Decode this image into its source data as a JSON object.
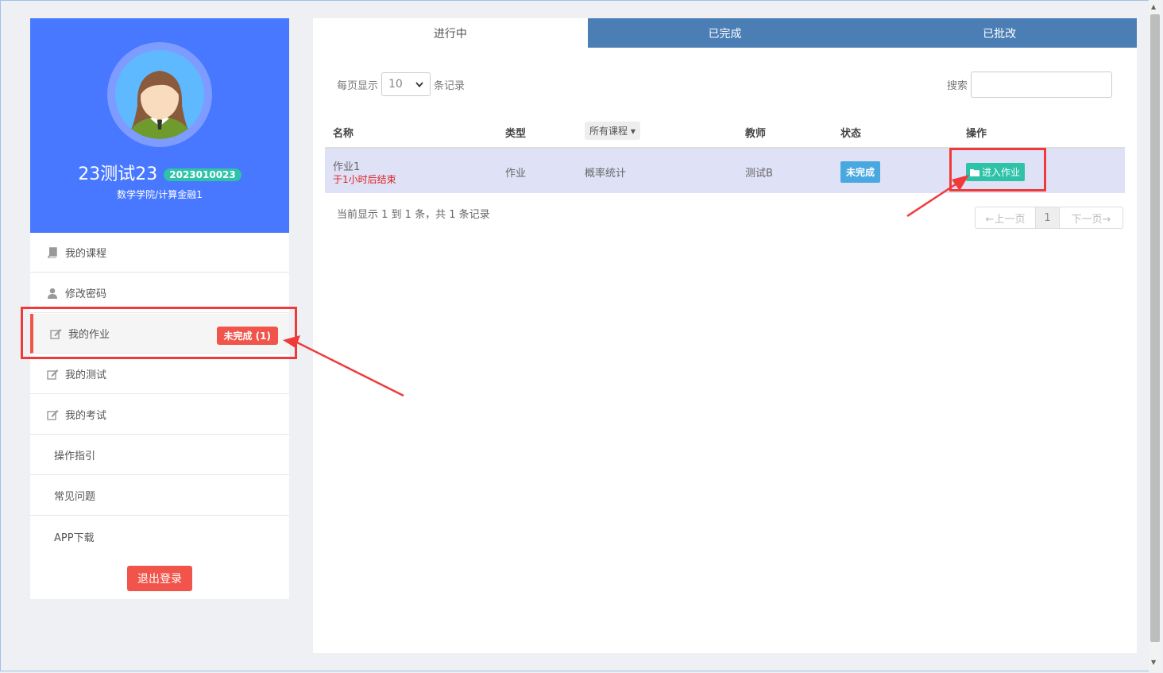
{
  "user": {
    "name": "23测试23",
    "student_id": "2023010023",
    "department": "数学学院/计算金融1"
  },
  "sidebar": {
    "items": [
      {
        "label": "我的课程",
        "icon": "book-icon"
      },
      {
        "label": "修改密码",
        "icon": "user-icon"
      },
      {
        "label": "我的作业",
        "icon": "edit-icon",
        "badge": "未完成 (1)"
      },
      {
        "label": "我的测试",
        "icon": "edit-icon"
      },
      {
        "label": "我的考试",
        "icon": "edit-icon"
      },
      {
        "label": "操作指引"
      },
      {
        "label": "常见问题"
      },
      {
        "label": "APP下载"
      }
    ],
    "logout_label": "退出登录"
  },
  "tabs": [
    {
      "label": "进行中",
      "active": true
    },
    {
      "label": "已完成",
      "active": false
    },
    {
      "label": "已批改",
      "active": false
    }
  ],
  "controls": {
    "per_page_prefix": "每页显示",
    "per_page_value": "10",
    "per_page_suffix": "条记录",
    "search_label": "搜索"
  },
  "table": {
    "headers": {
      "name": "名称",
      "type": "类型",
      "course_filter": "所有课程",
      "teacher": "教师",
      "status": "状态",
      "action": "操作"
    },
    "rows": [
      {
        "name": "作业1",
        "deadline": "于1小时后结束",
        "type": "作业",
        "course": "概率统计",
        "teacher": "测试B",
        "status": "未完成",
        "action": "进入作业"
      }
    ]
  },
  "footer": {
    "info": "当前显示 1 到 1 条，共 1 条记录",
    "prev": "←上一页",
    "page": "1",
    "next": "下一页→"
  },
  "colors": {
    "profile_bg": "#4778ff",
    "tab_bg": "#4a7eb5",
    "accent_red": "#f0544a",
    "accent_green": "#2ec3a8",
    "status_blue": "#4aa8e0",
    "row_highlight": "#dfe1f7"
  }
}
